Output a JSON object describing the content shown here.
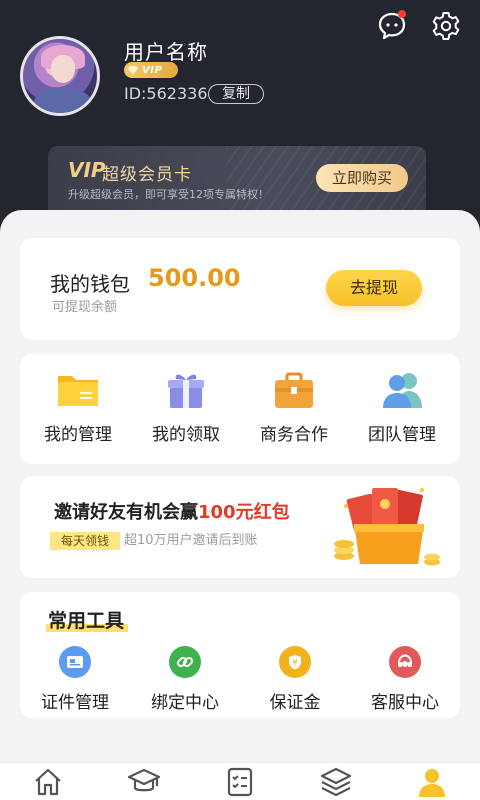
{
  "profile": {
    "name": "用户名称",
    "vip_badge": "VIP",
    "id_text": "ID:562336",
    "copy_label": "复制"
  },
  "vip_card": {
    "logo": "VIP",
    "title": "超级会员卡",
    "subtitle": "升级超级会员，即可享受12项专属特权！",
    "buy_label": "立即购买"
  },
  "wallet": {
    "title": "我的钱包",
    "subtitle": "可提现余额",
    "amount": "500.00",
    "withdraw_label": "去提现"
  },
  "menu": {
    "items": [
      {
        "label": "我的管理",
        "icon": "folder-icon"
      },
      {
        "label": "我的领取",
        "icon": "gift-box-icon"
      },
      {
        "label": "商务合作",
        "icon": "briefcase-icon"
      },
      {
        "label": "团队管理",
        "icon": "team-icon"
      }
    ]
  },
  "invite": {
    "title_prefix": "邀请好友有机会赢",
    "title_highlight": "100元红包",
    "tag": "每天领钱",
    "subtitle": "超10万用户邀请后到账"
  },
  "tools": {
    "title": "常用工具",
    "items": [
      {
        "label": "证件管理",
        "icon": "id-card-icon",
        "color": "#5b9cf0"
      },
      {
        "label": "绑定中心",
        "icon": "link-icon",
        "color": "#3fb24f"
      },
      {
        "label": "保证金",
        "icon": "deposit-icon",
        "color": "#f3b21c"
      },
      {
        "label": "客服中心",
        "icon": "customer-service-icon",
        "color": "#e15a5a"
      }
    ]
  },
  "tabbar": {
    "items": [
      {
        "icon": "home-icon",
        "active": false
      },
      {
        "icon": "graduation-cap-icon",
        "active": false
      },
      {
        "icon": "checklist-icon",
        "active": false
      },
      {
        "icon": "layers-icon",
        "active": false
      },
      {
        "icon": "user-icon",
        "active": true
      }
    ]
  },
  "colors": {
    "header_bg": "#23262f",
    "accent_gold": "#e59a1a",
    "accent_yellow": "#ffd54a",
    "highlight_red": "#e23a2a"
  }
}
